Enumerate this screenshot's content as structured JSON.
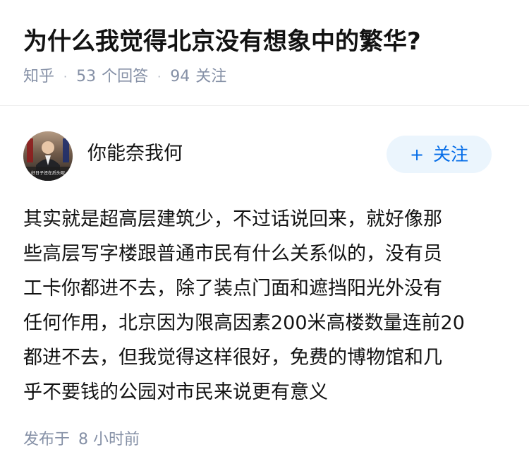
{
  "question": {
    "title": "为什么我觉得北京没有想象中的繁华?",
    "meta": {
      "source": "知乎",
      "answer_count": "53",
      "answer_label": "个回答",
      "follow_count": "94",
      "follow_label": "关注"
    }
  },
  "answer": {
    "author": {
      "name": "你能奈我何",
      "avatar_caption": "好日子还在后头呢",
      "avatar_icon": "profile-photo-icon"
    },
    "follow_button": {
      "icon": "plus-icon",
      "icon_glyph": "+",
      "label": "关注"
    },
    "content_lines": [
      "其实就是超高层建筑少，不过话说回来，就好像那",
      "些高层写字楼跟普通市民有什么关系似的，没有员",
      "工卡你都进不去，除了装点门面和遮挡阳光外没有",
      "任何作用，北京因为限高因素200米高楼数量连前20",
      "都进不去，但我觉得这样很好，免费的博物馆和几",
      "乎不要钱的公园对市民来说更有意义"
    ],
    "publish": {
      "label": "发布于",
      "time": "8 小时前"
    }
  },
  "colors": {
    "text_primary": "#121212",
    "text_secondary": "#8590a6",
    "accent": "#056de8",
    "follow_bg": "#ebf5fd",
    "divider": "#eeeeee"
  }
}
